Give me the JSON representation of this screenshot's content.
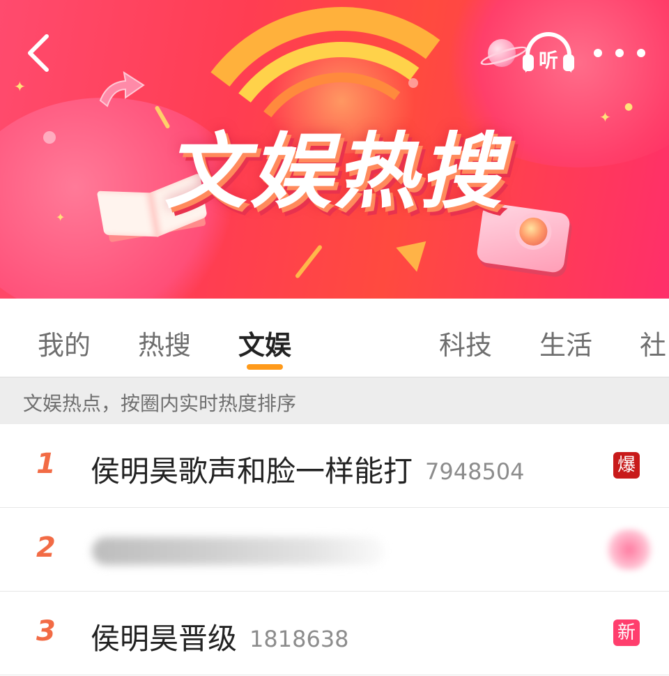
{
  "banner": {
    "title": "文娱热搜",
    "listen_label": "听",
    "colors": {
      "bg": "#ff3d52",
      "accent": "#ffb13c"
    }
  },
  "tabs": [
    {
      "label": "我的",
      "active": false
    },
    {
      "label": "热搜",
      "active": false
    },
    {
      "label": "文娱",
      "active": true
    },
    {
      "label": "科技",
      "active": false
    },
    {
      "label": "生活",
      "active": false
    },
    {
      "label": "社",
      "active": false
    }
  ],
  "subheader": {
    "text": "文娱热点，按圈内实时热度排序"
  },
  "list": [
    {
      "rank": "1",
      "title": "侯明昊歌声和脸一样能打",
      "heat": "7948504",
      "badge": "爆",
      "badge_color": "#c81a1a"
    },
    {
      "rank": "2",
      "title": "",
      "heat": "",
      "badge": "",
      "obscured": true
    },
    {
      "rank": "3",
      "title": "侯明昊晋级",
      "heat": "1818638",
      "badge": "新",
      "badge_color": "#ff3e6d"
    }
  ],
  "icons": [
    "back-arrow-icon",
    "headphones-icon",
    "more-dots-icon"
  ],
  "indicator_color": "#ff9a1a"
}
